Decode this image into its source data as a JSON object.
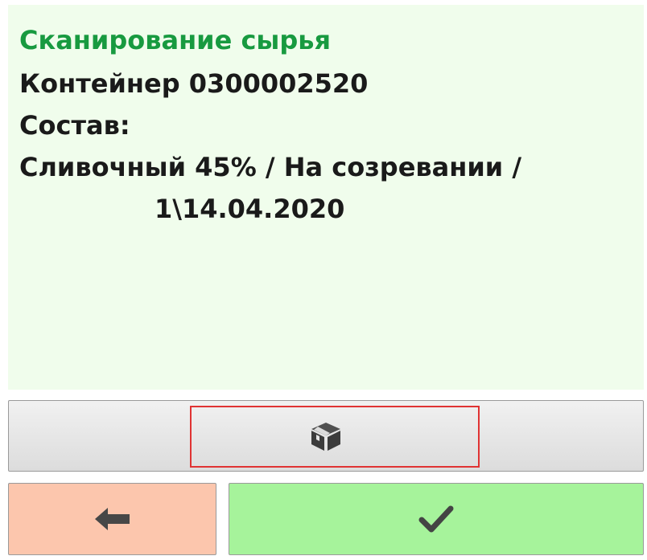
{
  "screen": {
    "title": "Сканирование сырья",
    "container_line": "Контейнер 0300002520",
    "composition_label": "Состав:",
    "composition_value": "Сливочный 45% / На созревании /",
    "composition_date": "1\\14.04.2020"
  },
  "buttons": {
    "box_icon": "box-icon",
    "back_icon": "arrow-left-icon",
    "ok_icon": "checkmark-icon"
  },
  "colors": {
    "title": "#189a40",
    "panel_bg": "#f0fdec",
    "back_bg": "#fcc6ad",
    "ok_bg": "#a6f39b",
    "focus_frame": "#e03333"
  }
}
